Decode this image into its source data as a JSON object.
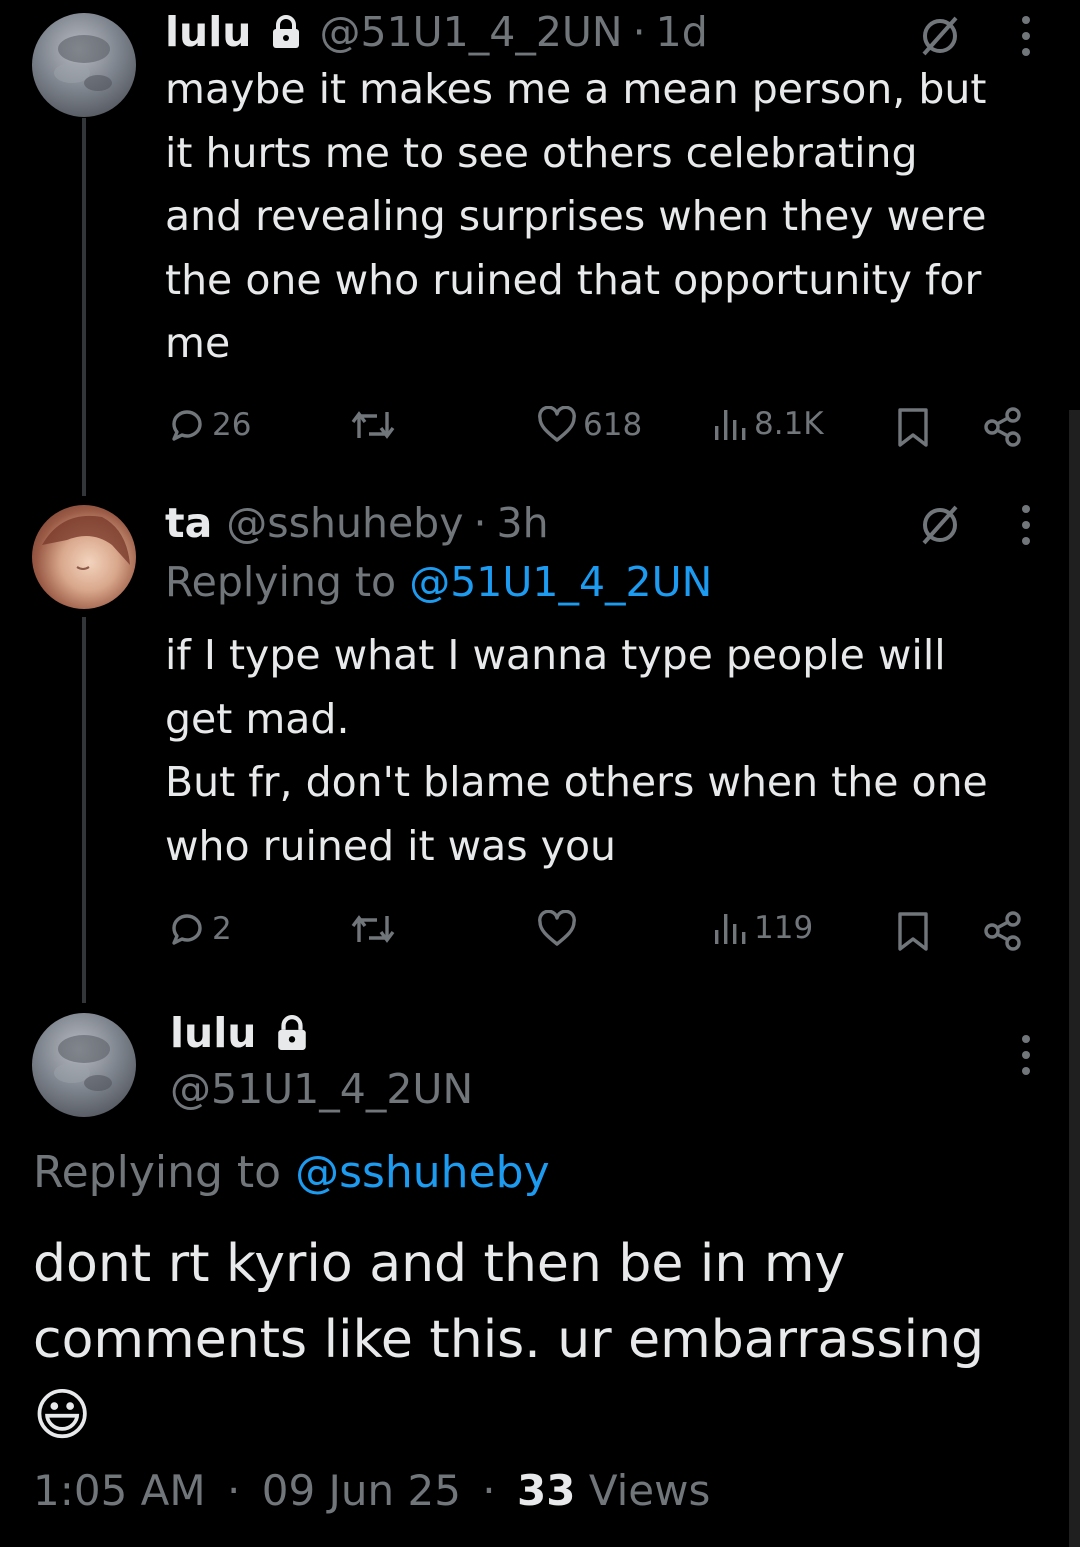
{
  "tweet1": {
    "name": "lulu",
    "handle": "@51U1_4_2UN",
    "sep": "·",
    "age": "1d",
    "lines": [
      "maybe it makes me a mean person, but",
      "it hurts me to see others celebrating",
      "and revealing surprises when they were",
      "the one who ruined that opportunity for",
      "me"
    ],
    "replies": "26",
    "likes": "618",
    "views": "8.1K"
  },
  "tweet2": {
    "name": "ta",
    "handle": "@sshuheby",
    "sep": "·",
    "age": "3h",
    "replying_label": "Replying to",
    "replying_to": "@51U1_4_2UN",
    "lines": [
      "if I type what I wanna type people will",
      "get mad.",
      "But fr, don't blame others when the one",
      "who ruined it was you"
    ],
    "replies": "2",
    "views": "119"
  },
  "main": {
    "name": "lulu",
    "handle": "@51U1_4_2UN",
    "replying_label": "Replying to",
    "replying_to": "@sshuheby",
    "lines": [
      "dont rt kyrio and then be in my",
      "comments like this. ur embarrassing"
    ],
    "emoji": "😃",
    "time": "1:05 AM",
    "date": "09 Jun 25",
    "sep": "·",
    "views_count": "33",
    "views_label": "Views"
  },
  "colors": {
    "background": "#000000",
    "text": "#e7e9ea",
    "muted": "#71767b",
    "link": "#1d9bf0",
    "thread_line": "#333639"
  },
  "icons": [
    "lock-icon",
    "grok-icon",
    "more-icon",
    "reply-icon",
    "retweet-icon",
    "like-icon",
    "views-icon",
    "bookmark-icon",
    "share-icon"
  ]
}
